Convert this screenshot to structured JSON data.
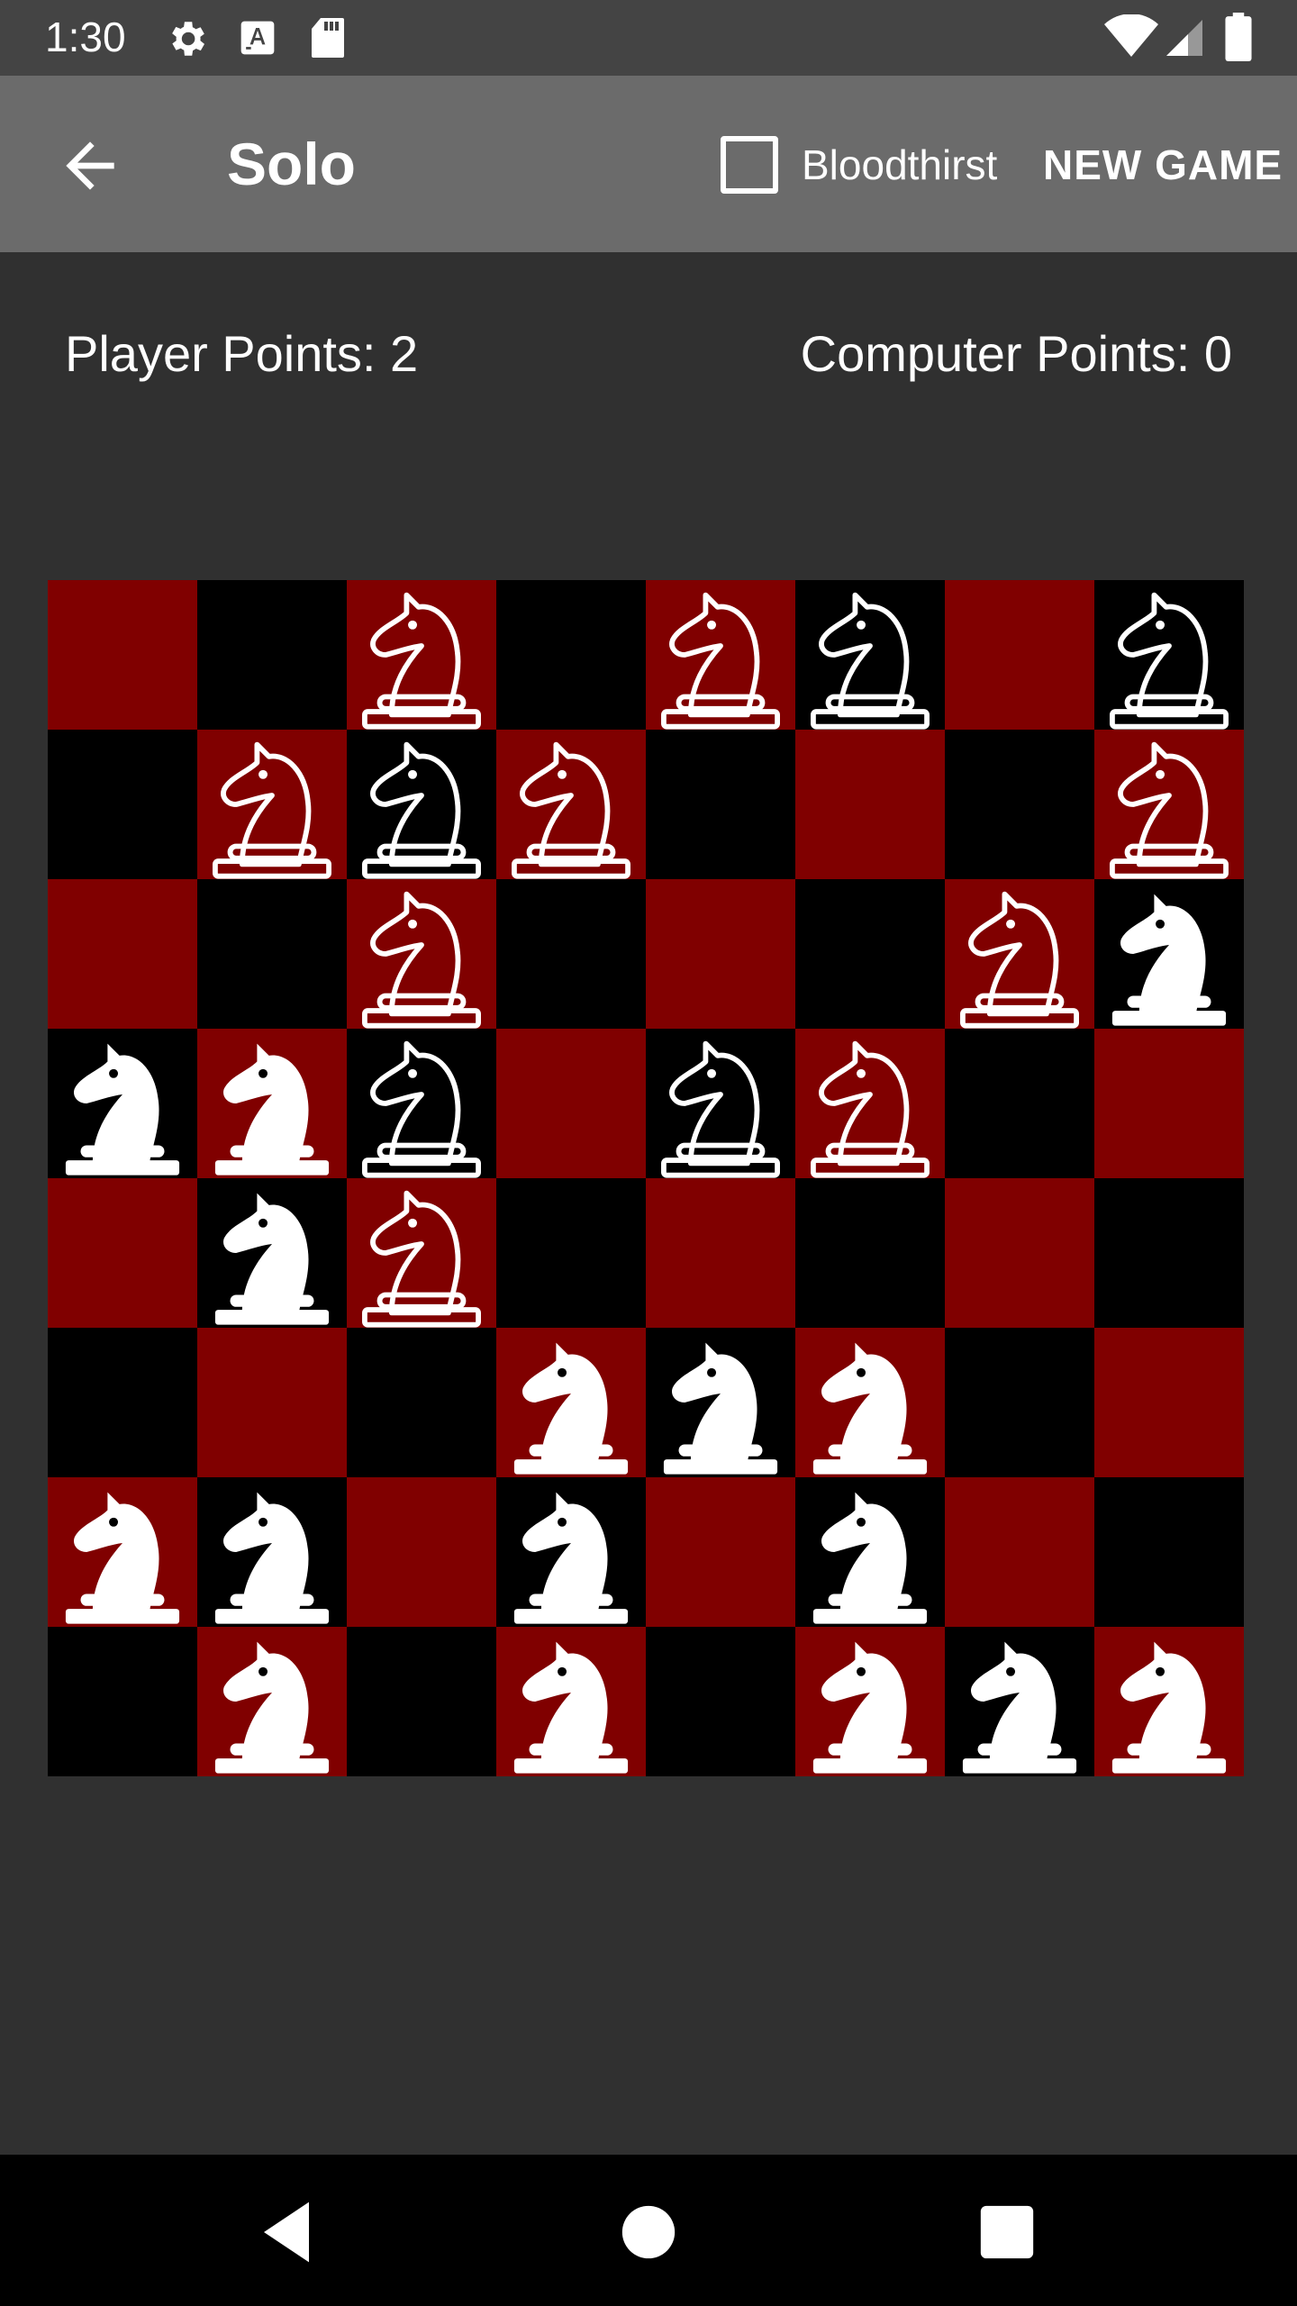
{
  "status_bar": {
    "time": "1:30",
    "icons": [
      "settings-icon",
      "font-icon",
      "sd-card-icon",
      "wifi-icon",
      "signal-icon",
      "battery-icon"
    ]
  },
  "app_bar": {
    "back_icon": "arrow-back-icon",
    "title": "Solo",
    "checkbox_label": "Bloodthirst",
    "checkbox_checked": false,
    "new_game_label": "NEW GAME"
  },
  "scores": {
    "player": "Player Points: 2",
    "computer": "Computer Points: 0"
  },
  "board": {
    "colors": {
      "red": "#800000",
      "black": "#000000"
    },
    "rows": [
      "..o.oo.o",
      ".ooo...o",
      "..o...ow",
      "wwo.oo..",
      ".wo.....",
      "...www..",
      "ww.w.w..",
      ".w.w.www"
    ]
  },
  "nav_bar": {
    "icons": [
      "nav-back-icon",
      "nav-home-icon",
      "nav-recents-icon"
    ]
  }
}
